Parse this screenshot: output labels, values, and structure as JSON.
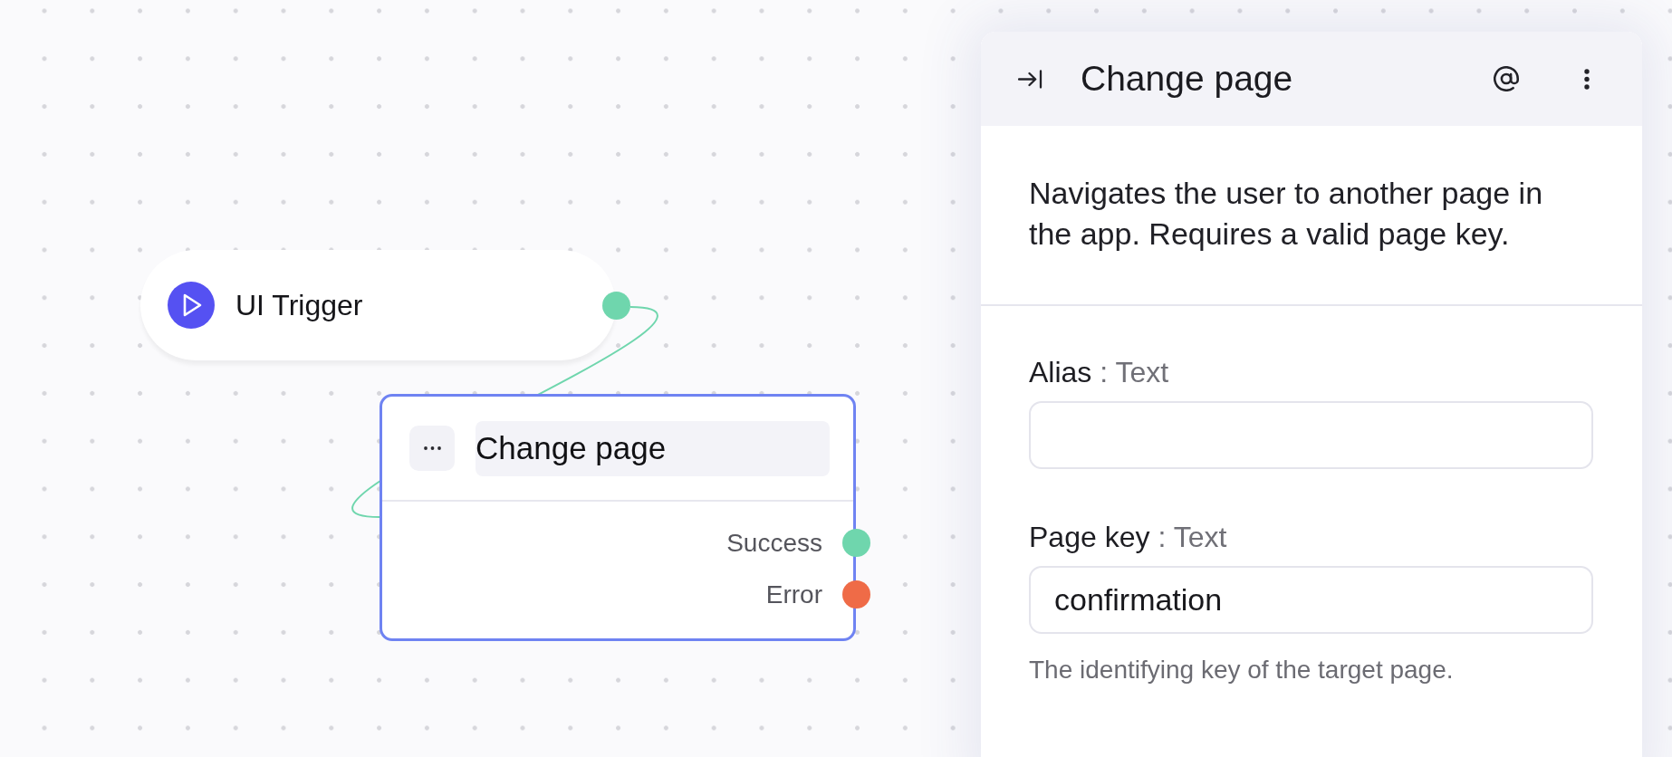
{
  "canvas": {
    "nodes": [
      {
        "kind": "trigger",
        "title": "UI Trigger",
        "selected": false
      },
      {
        "kind": "action",
        "title": "Change page",
        "selected": true,
        "outputs": [
          {
            "label": "Success",
            "color": "#6fd6ad"
          },
          {
            "label": "Error",
            "color": "#ef6b47"
          }
        ]
      }
    ]
  },
  "panel": {
    "title": "Change page",
    "description": "Navigates the user to another page in the app. Requires a valid page key.",
    "fields": [
      {
        "label": "Alias",
        "type": ": Text"
      },
      {
        "label": "Page key",
        "type": ": Text",
        "value": "confirmation",
        "hint": "The identifying key of the target page."
      }
    ]
  }
}
